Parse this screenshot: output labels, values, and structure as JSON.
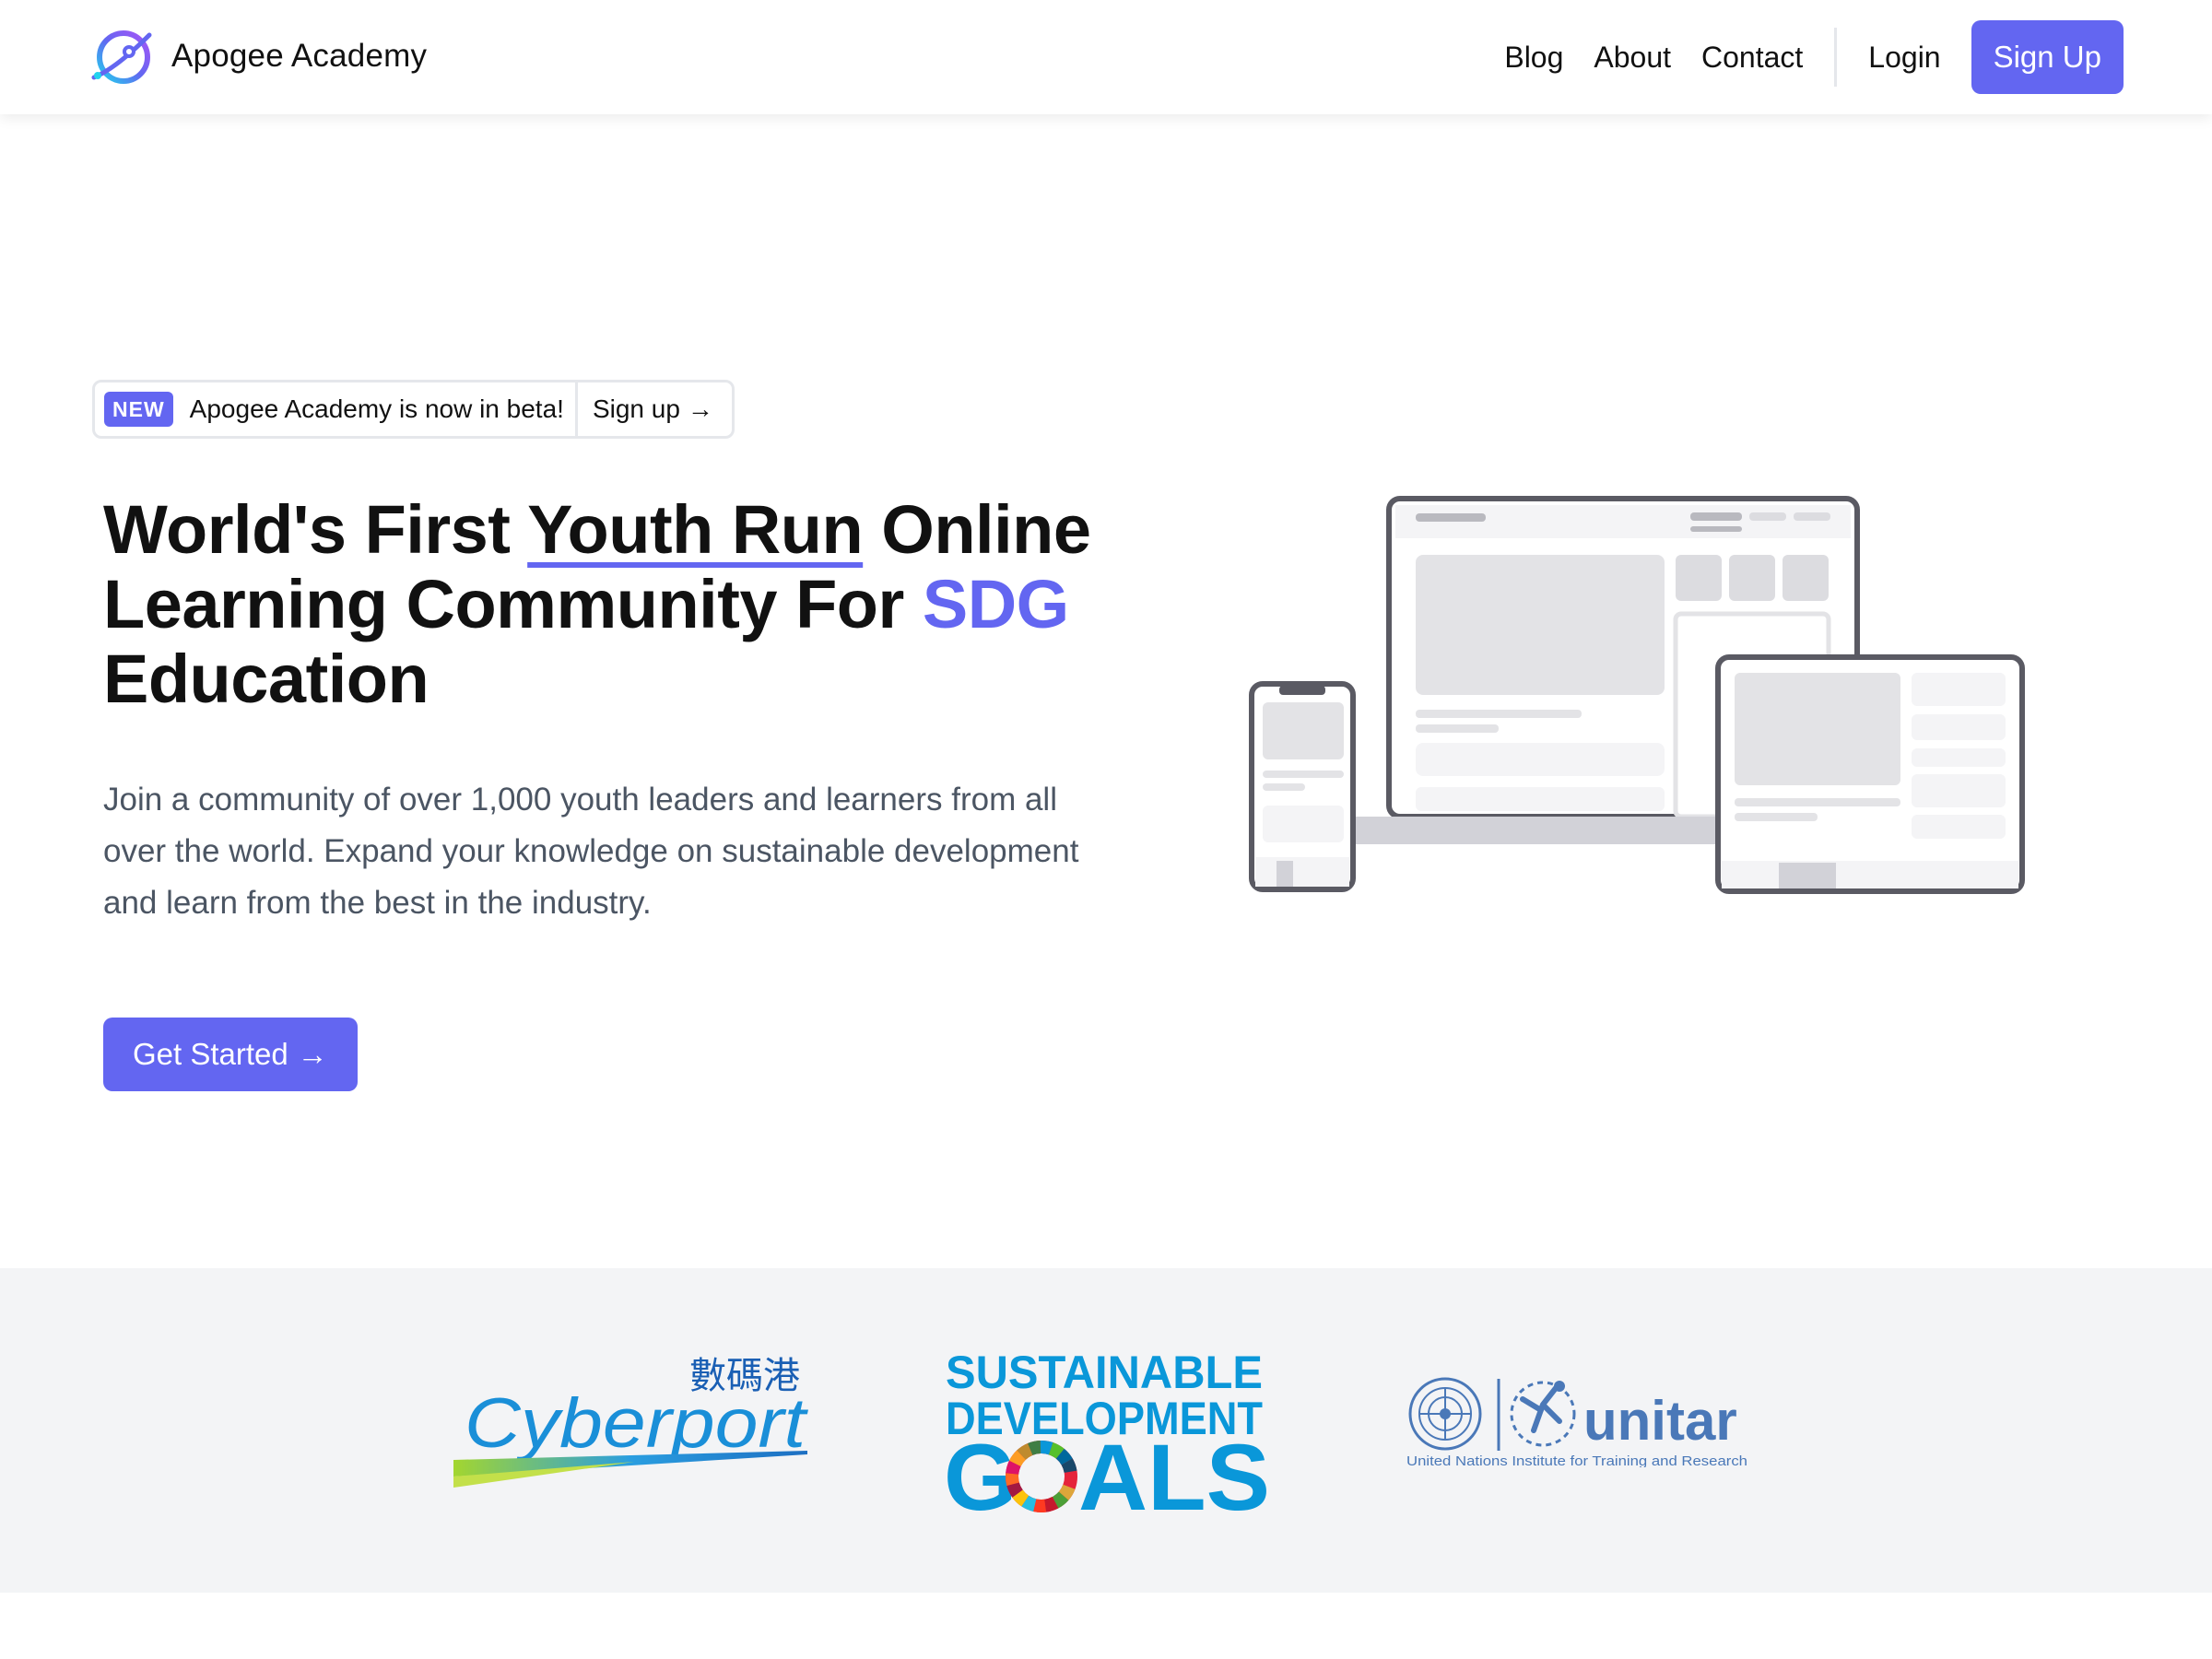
{
  "navbar": {
    "brand_name": "Apogee Academy",
    "links": [
      "Blog",
      "About",
      "Contact"
    ],
    "login_label": "Login",
    "signup_label": "Sign Up"
  },
  "hero": {
    "badge": "NEW",
    "announcement": "Apogee Academy is now in beta!",
    "announcement_link": "Sign up",
    "arrow": "→",
    "title_part1": "World's First ",
    "title_highlight": "Youth Run",
    "title_part2": " Online Learning Community For ",
    "title_accent": "SDG",
    "title_part3": " Education",
    "description": "Join a community of over 1,000 youth leaders and learners from all over the world. Expand your knowledge on sustainable development and learn from the best in the industry.",
    "cta_label": "Get Started"
  },
  "partners": {
    "cyberport_chinese": "數碼港",
    "cyberport_name": "Cyberport",
    "sdg_line1": "SUSTAINABLE",
    "sdg_line2": "DEVELOPMENT",
    "sdg_line3_a": "G",
    "sdg_line3_b": "ALS",
    "unitar_name": "unitar",
    "unitar_subtitle": "United Nations Institute for Training and Research"
  },
  "colors": {
    "accent": "#6366f1",
    "sdg_blue": "#0a97d9",
    "unitar_blue": "#4a78b8",
    "partners_bg": "#f3f4f6"
  }
}
